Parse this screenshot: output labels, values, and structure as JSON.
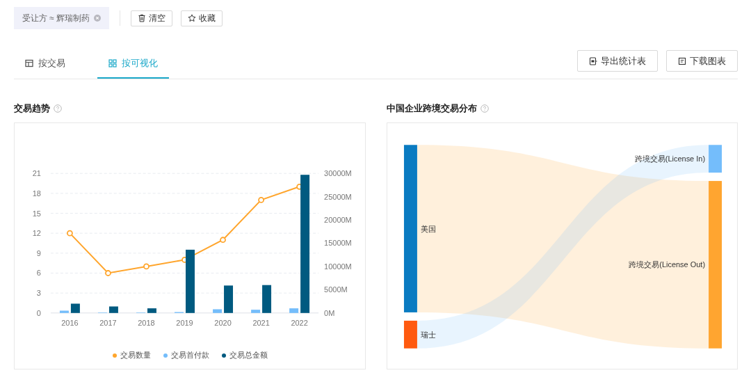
{
  "filter_chip": {
    "label": "受让方 ≈ 辉瑞制药"
  },
  "toolbar_buttons": [
    {
      "label": "清空",
      "kind": "trash"
    },
    {
      "label": "收藏",
      "kind": "star"
    }
  ],
  "tabs": [
    {
      "label": "按交易",
      "kind": "table",
      "selected": false
    },
    {
      "label": "按可视化",
      "kind": "grid",
      "selected": true
    }
  ],
  "actions": [
    {
      "label": "导出统计表",
      "kind": "export"
    },
    {
      "label": "下载图表",
      "kind": "download"
    }
  ],
  "trend_panel": {
    "title": "交易趋势",
    "count_chart": {
      "chart_data": {
        "type": "line",
        "series": [
          {
            "name": "交易数量",
            "color": "#ffa52c",
            "marker": "circle",
            "values": [
              12,
              6,
              7,
              8,
              11,
              17,
              19
            ]
          }
        ],
        "grid": true,
        "ylim": [
          0,
          21
        ],
        "yticks": [
          0,
          3,
          6,
          9,
          12,
          15,
          18,
          21
        ]
      }
    },
    "amount_chart": {
      "chart_data": {
        "type": "bar",
        "categories": [
          "2016",
          "2017",
          "2018",
          "2019",
          "2020",
          "2021",
          "2022"
        ],
        "series": [
          {
            "name": "交易首付款",
            "color": "#74bdfb",
            "values": [
              500,
              100,
              100,
              200,
              800,
              700,
              1000
            ]
          },
          {
            "name": "交易总金额",
            "color": "#005a80",
            "values": [
              2000,
              1400,
              1000,
              13600,
              5900,
              6000,
              29700
            ]
          }
        ],
        "ylim": [
          0,
          30000
        ],
        "yticks": [
          {
            "value": 0,
            "label": "0M"
          },
          {
            "value": 5000,
            "label": "5000M"
          },
          {
            "value": 10000,
            "label": "10000M"
          },
          {
            "value": 15000,
            "label": "15000M"
          },
          {
            "value": 20000,
            "label": "20000M"
          },
          {
            "value": 25000,
            "label": "25000M"
          },
          {
            "value": 30000,
            "label": "30000M"
          }
        ]
      }
    }
  },
  "distribution_panel": {
    "title": "中国企业跨境交易分布",
    "sources": [
      {
        "label": "美国",
        "color": "#0a7bc1"
      },
      {
        "label": "瑞士",
        "color": "#ff5a0f"
      }
    ],
    "targets": [
      {
        "label": "跨境交易(License In)",
        "color": "#74bdfb"
      },
      {
        "label": "跨境交易(License Out)",
        "color": "#ffa530"
      }
    ]
  }
}
